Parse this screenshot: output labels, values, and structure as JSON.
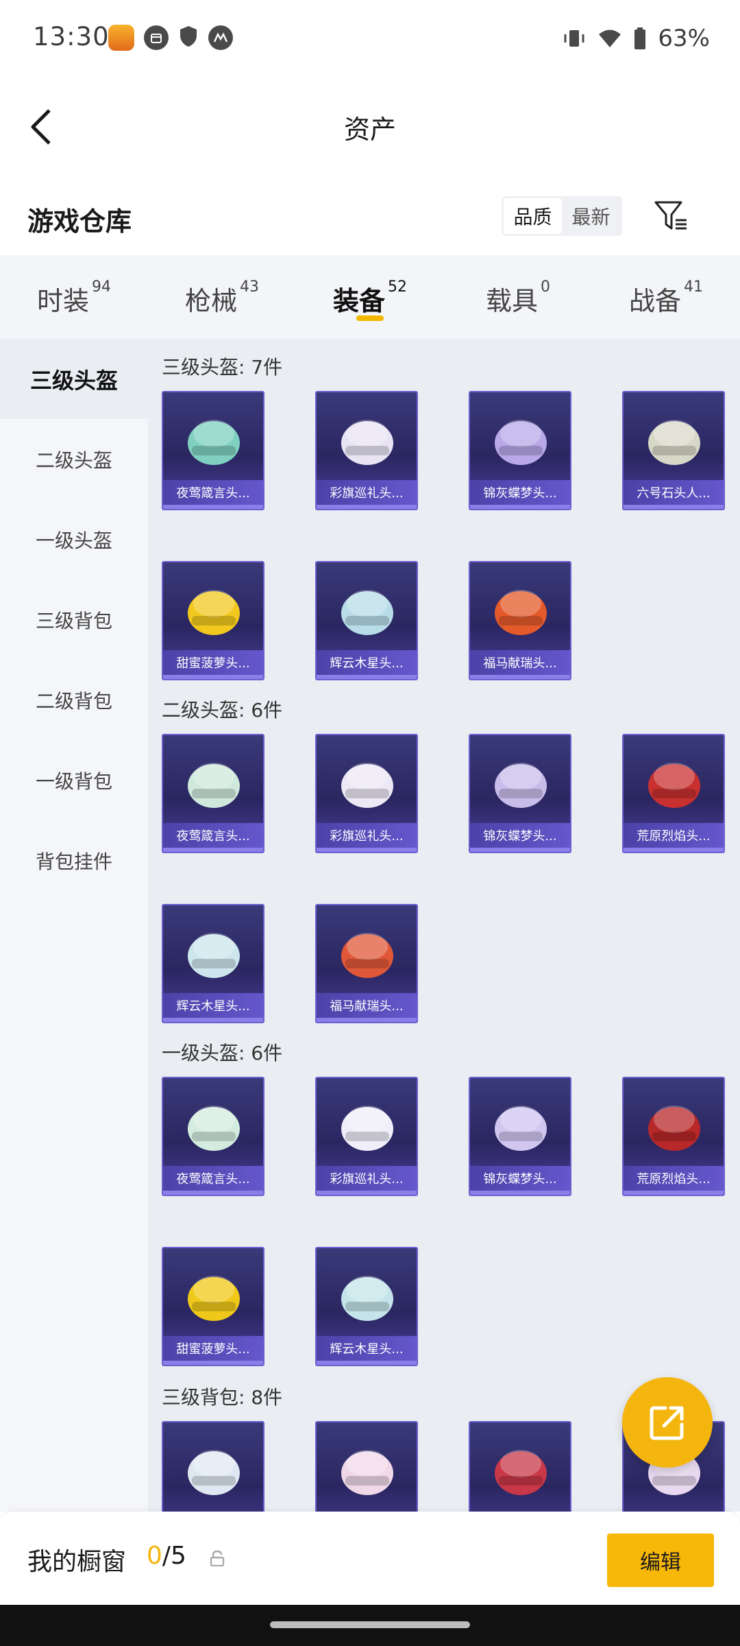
{
  "status_bar": {
    "time": "13:30",
    "battery": "63%"
  },
  "header": {
    "title": "资产"
  },
  "warehouse": {
    "title": "游戏仓库",
    "sort_options": [
      "品质",
      "最新"
    ],
    "active_sort": 0
  },
  "tabs": [
    {
      "label": "时装",
      "count": "94"
    },
    {
      "label": "枪械",
      "count": "43"
    },
    {
      "label": "装备",
      "count": "52"
    },
    {
      "label": "载具",
      "count": "0"
    },
    {
      "label": "战备",
      "count": "41"
    }
  ],
  "active_tab": 2,
  "sidebar": [
    {
      "label": "三级头盔"
    },
    {
      "label": "二级头盔"
    },
    {
      "label": "一级头盔"
    },
    {
      "label": "三级背包"
    },
    {
      "label": "二级背包"
    },
    {
      "label": "一级背包"
    },
    {
      "label": "背包挂件"
    }
  ],
  "active_sidebar": 0,
  "groups": [
    {
      "title": "三级头盔: 7件",
      "items": [
        {
          "label": "夜莺箴言头...",
          "color": "#7fd0c0"
        },
        {
          "label": "彩旗巡礼头...",
          "color": "#e8e4f4"
        },
        {
          "label": "锦灰蝶梦头...",
          "color": "#b8a8e8"
        },
        {
          "label": "六号石头人...",
          "color": "#d8d8c8"
        },
        {
          "label": "甜蜜菠萝头...",
          "color": "#f2c81e"
        },
        {
          "label": "辉云木星头...",
          "color": "#b8dce8"
        },
        {
          "label": "福马献瑞头...",
          "color": "#e45a2a"
        }
      ]
    },
    {
      "title": "二级头盔: 6件",
      "items": [
        {
          "label": "夜莺箴言头...",
          "color": "#cfe8dc"
        },
        {
          "label": "彩旗巡礼头...",
          "color": "#ece8f6"
        },
        {
          "label": "锦灰蝶梦头...",
          "color": "#c8bcea"
        },
        {
          "label": "荒原烈焰头...",
          "color": "#c83030"
        },
        {
          "label": "辉云木星头...",
          "color": "#cde6ee"
        },
        {
          "label": "福马献瑞头...",
          "color": "#e05838"
        }
      ]
    },
    {
      "title": "一级头盔: 6件",
      "items": [
        {
          "label": "夜莺箴言头...",
          "color": "#d4ecdf"
        },
        {
          "label": "彩旗巡礼头...",
          "color": "#f0eef8"
        },
        {
          "label": "锦灰蝶梦头...",
          "color": "#d0c6f0"
        },
        {
          "label": "荒原烈焰头...",
          "color": "#b82828"
        },
        {
          "label": "甜蜜菠萝头...",
          "color": "#f0c81a"
        },
        {
          "label": "辉云木星头...",
          "color": "#c4e4ea"
        }
      ]
    },
    {
      "title": "三级背包: 8件",
      "items": [
        {
          "label": "",
          "color": "#dfe8f2"
        },
        {
          "label": "",
          "color": "#f0d8e8"
        },
        {
          "label": "",
          "color": "#c83848"
        },
        {
          "label": "",
          "color": "#e8d8f0"
        }
      ]
    }
  ],
  "showcase": {
    "label": "我的橱窗",
    "current": "0",
    "total": "/5",
    "edit_label": "编辑"
  },
  "icons": [
    "back-arrow-icon",
    "filter-icon",
    "share-icon",
    "lock-icon"
  ]
}
